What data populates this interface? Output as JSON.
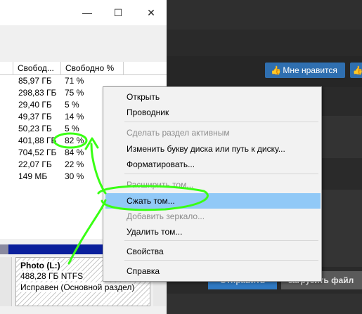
{
  "background_app": {
    "like_button_label": "Мне нравится",
    "like_button_icon": "thumbs-up-icon",
    "primary_button_label": "Отправить",
    "upload_button_label": "загрузить файл"
  },
  "window": {
    "controls": {
      "minimize": "—",
      "maximize": "☐",
      "close": "✕"
    },
    "table": {
      "headers": [
        "Свобод...",
        "Свободно %"
      ],
      "rows": [
        {
          "free": "85,97 ГБ",
          "pct": "71 %"
        },
        {
          "free": "298,83 ГБ",
          "pct": "75 %"
        },
        {
          "free": "29,40 ГБ",
          "pct": "5 %"
        },
        {
          "free": "49,37 ГБ",
          "pct": "14 %"
        },
        {
          "free": "50,23 ГБ",
          "pct": "5 %"
        },
        {
          "free": "401,88 ГБ",
          "pct": "82 %"
        },
        {
          "free": "704,52 ГБ",
          "pct": "84 %"
        },
        {
          "free": "22,07 ГБ",
          "pct": "22 %"
        },
        {
          "free": "149 МБ",
          "pct": "30 %"
        }
      ]
    },
    "partition": {
      "name": "Photo  (L:)",
      "size": "488,28 ГБ NTFS",
      "status": "Исправен (Основной раздел)"
    }
  },
  "context_menu": {
    "items": [
      {
        "label": "Открыть",
        "disabled": false
      },
      {
        "label": "Проводник",
        "disabled": false
      },
      {
        "label": "Сделать раздел активным",
        "disabled": true
      },
      {
        "label": "Изменить букву диска или путь к диску...",
        "disabled": false
      },
      {
        "label": "Форматировать...",
        "disabled": false
      },
      {
        "label": "Расширить том...",
        "disabled": true
      },
      {
        "label": "Сжать том...",
        "disabled": false,
        "highlighted": true
      },
      {
        "label": "Добавить зеркало...",
        "disabled": true
      },
      {
        "label": "Удалить том...",
        "disabled": false
      },
      {
        "label": "Свойства",
        "disabled": false
      },
      {
        "label": "Справка",
        "disabled": false
      }
    ]
  },
  "colors": {
    "highlight": "#91c9f7",
    "annotation": "#39ff14",
    "accent_blue": "#2f79c2"
  }
}
